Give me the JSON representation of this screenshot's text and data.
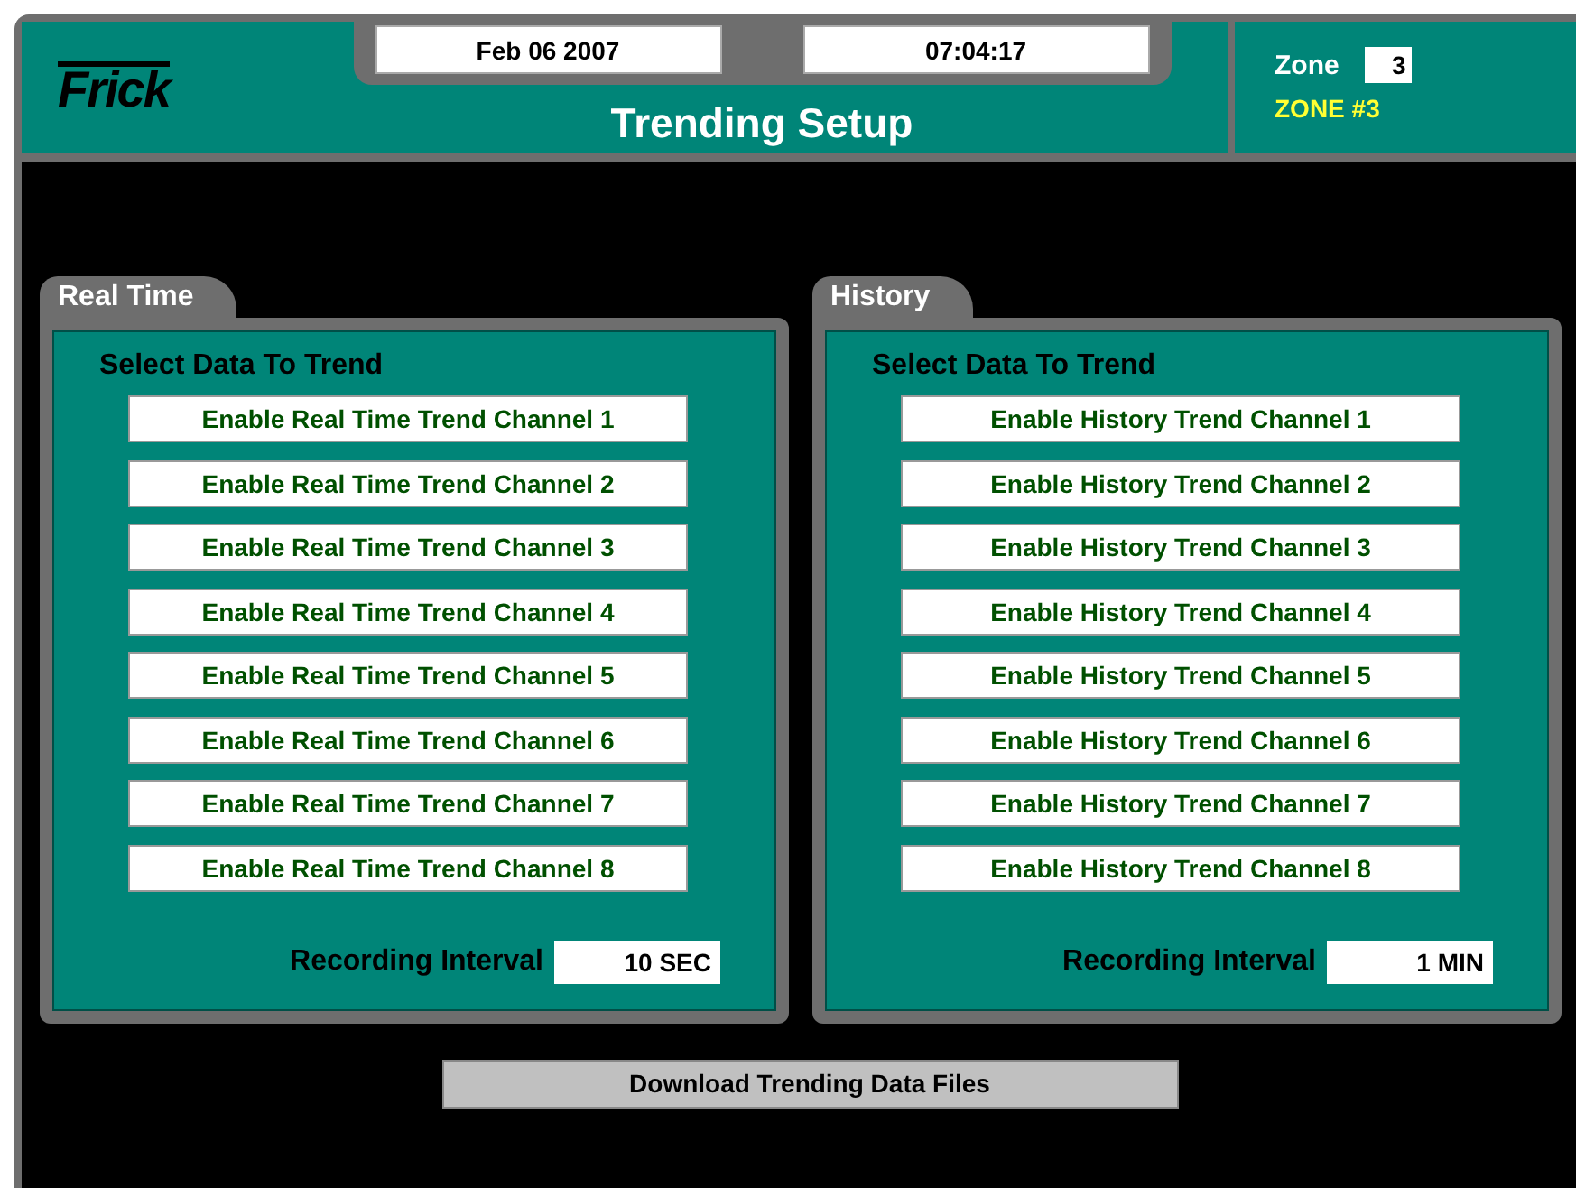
{
  "header": {
    "logo": "Frick",
    "date": "Feb 06 2007",
    "time": "07:04:17",
    "title": "Trending Setup",
    "zone_label": "Zone",
    "zone_value": "3",
    "zone_name": "ZONE #3"
  },
  "panels": [
    {
      "tab": "Real Time",
      "heading": "Select Data To Trend",
      "channels": [
        "Enable Real Time Trend Channel 1",
        "Enable Real Time Trend Channel 2",
        "Enable Real Time Trend Channel 3",
        "Enable Real Time Trend Channel 4",
        "Enable Real Time Trend Channel 5",
        "Enable Real Time Trend Channel 6",
        "Enable Real Time Trend Channel 7",
        "Enable Real Time Trend Channel 8"
      ],
      "interval_label": "Recording Interval",
      "interval_value": "10 SEC"
    },
    {
      "tab": "History",
      "heading": "Select Data To Trend",
      "channels": [
        "Enable History Trend Channel 1",
        "Enable History Trend Channel 2",
        "Enable History Trend Channel 3",
        "Enable History Trend Channel 4",
        "Enable History Trend Channel 5",
        "Enable History Trend Channel 6",
        "Enable History Trend Channel 7",
        "Enable History Trend Channel 8"
      ],
      "interval_label": "Recording Interval",
      "interval_value": "1 MIN"
    }
  ],
  "download_button": "Download Trending Data Files"
}
